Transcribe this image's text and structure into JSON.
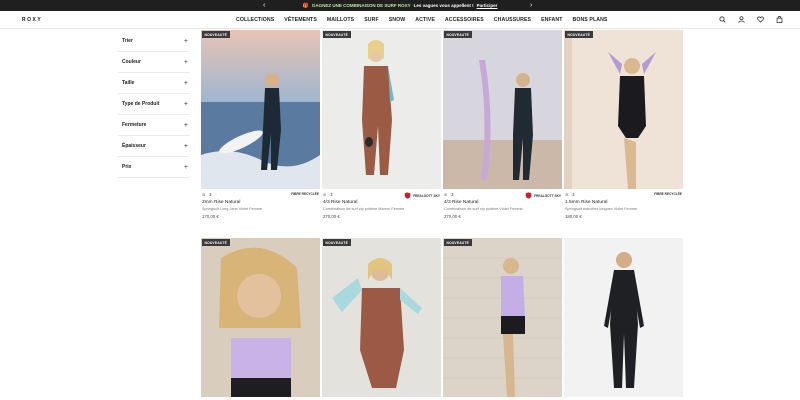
{
  "promo": {
    "prev": "‹",
    "next": "›",
    "highlight": "GAGNEZ UNE COMBINAISON DE SURF ROXY",
    "text": "Les vagues vous appellent !",
    "link": "Participer"
  },
  "header": {
    "logo": "ROXY",
    "nav": [
      "COLLECTIONS",
      "VÊTEMENTS",
      "MAILLOTS",
      "SURF",
      "SNOW",
      "ACTIVE",
      "ACCESSOIRES",
      "CHAUSSURES",
      "ENFANT",
      "BONS PLANS"
    ]
  },
  "filters": [
    "Trier",
    "Couleur",
    "Taille",
    "Type de Produit",
    "Fermeture",
    "Épaisseur",
    "Prix"
  ],
  "products": [
    {
      "badge": "NOUVEAUTÉ",
      "swatch": "⊘ ③",
      "tag": "FIBRE RECYCLÉE",
      "title": "2mm Rise Natural",
      "sub": "Springsuit Long Jane Violet Femme",
      "price": "170,00 €"
    },
    {
      "badge": "NOUVEAUTÉ",
      "swatch": "⊘ ③",
      "tag": "FREALGOTT SKY",
      "title": "4/3 Rise Natural",
      "sub": "Combinaison de surf zip poitrine Marron Femme",
      "price": "270,00 €"
    },
    {
      "badge": "NOUVEAUTÉ",
      "swatch": "⊘ ③",
      "tag": "FREALGOTT SKY",
      "title": "4/3 Rise Natural",
      "sub": "Combinaison de surf zip poitrine Violet Femme",
      "price": "270,00 €"
    },
    {
      "badge": "NOUVEAUTÉ",
      "swatch": "⊘ ③",
      "tag": "FIBRE RECYCLÉE",
      "title": "1.5mm Rise Natural",
      "sub": "Springsuit manches longues Violet Femme",
      "price": "180,00 €"
    },
    {
      "badge": "NOUVEAUTÉ"
    },
    {
      "badge": "NOUVEAUTÉ"
    },
    {
      "badge": "NOUVEAUTÉ"
    },
    {
      "badge": ""
    }
  ],
  "colors": {
    "promo_bg": "#1f1f1f",
    "badge_bg": "#3a3a3a",
    "tag_red": "#c8202f"
  }
}
